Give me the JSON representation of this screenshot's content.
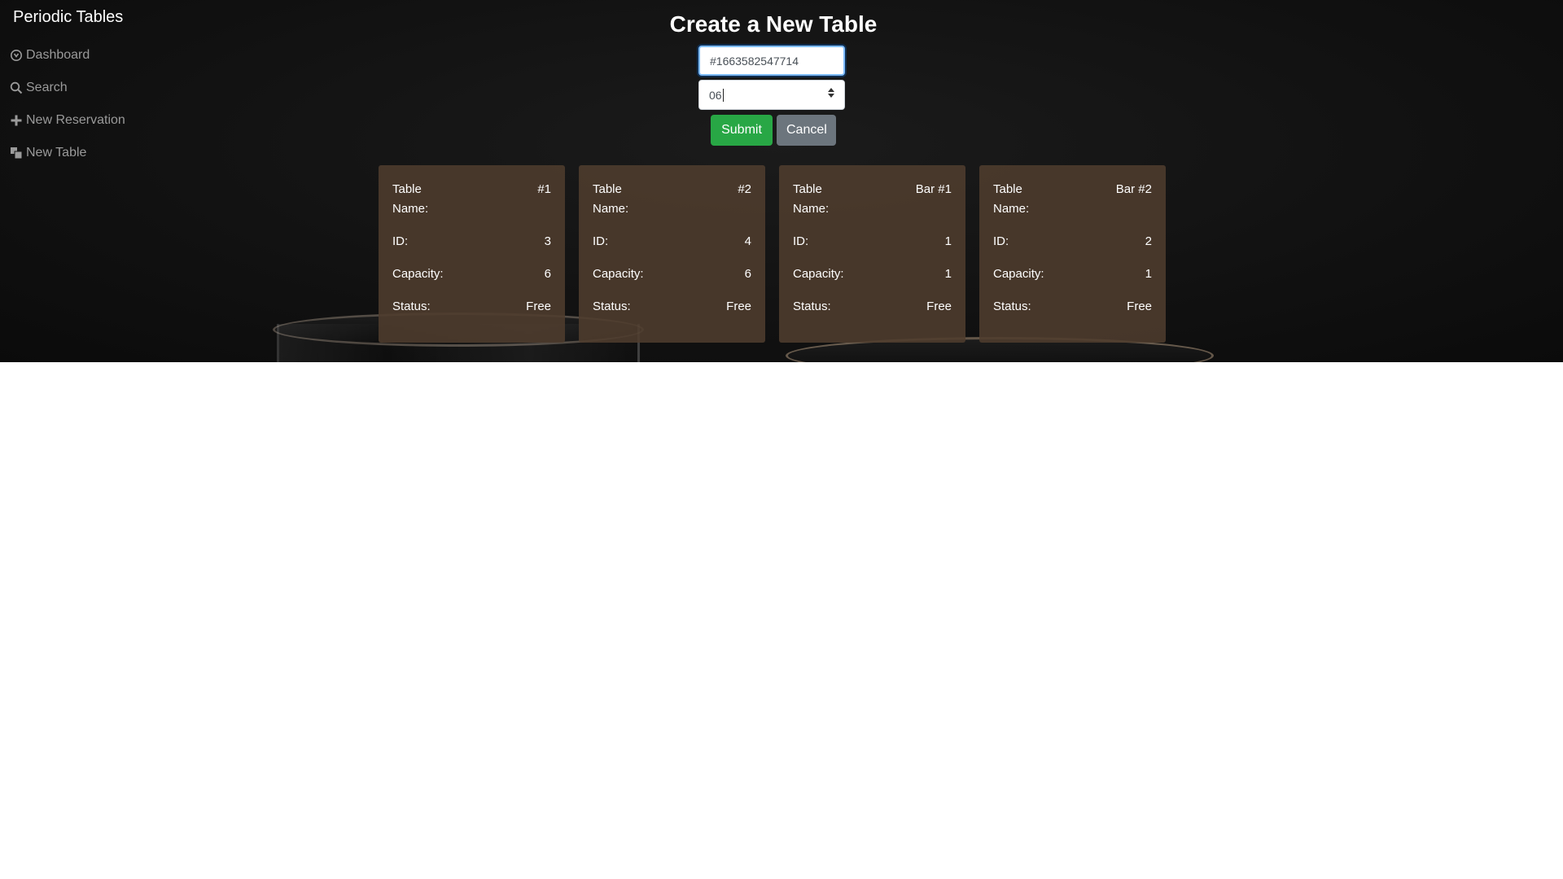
{
  "brand": "Periodic Tables",
  "nav": {
    "items": [
      {
        "label": "Dashboard",
        "icon": "dashboard-icon"
      },
      {
        "label": "Search",
        "icon": "search-icon"
      },
      {
        "label": "New Reservation",
        "icon": "plus-icon"
      },
      {
        "label": "New Table",
        "icon": "table-icon"
      }
    ]
  },
  "page": {
    "title": "Create a New Table"
  },
  "form": {
    "table_name_value": "#1663582547714",
    "capacity_value": "06",
    "submit_label": "Submit",
    "cancel_label": "Cancel"
  },
  "tables": [
    {
      "name_label": "Table Name:",
      "name": "#1",
      "id_label": "ID:",
      "id": "3",
      "capacity_label": "Capacity:",
      "capacity": "6",
      "status_label": "Status:",
      "status": "Free"
    },
    {
      "name_label": "Table Name:",
      "name": "#2",
      "id_label": "ID:",
      "id": "4",
      "capacity_label": "Capacity:",
      "capacity": "6",
      "status_label": "Status:",
      "status": "Free"
    },
    {
      "name_label": "Table Name:",
      "name": "Bar #1",
      "id_label": "ID:",
      "id": "1",
      "capacity_label": "Capacity:",
      "capacity": "1",
      "status_label": "Status:",
      "status": "Free"
    },
    {
      "name_label": "Table Name:",
      "name": "Bar #2",
      "id_label": "ID:",
      "id": "2",
      "capacity_label": "Capacity:",
      "capacity": "1",
      "status_label": "Status:",
      "status": "Free"
    }
  ],
  "colors": {
    "submit": "#28a745",
    "cancel": "#6c757d",
    "card": "#4e3c2e",
    "background": "#111111"
  }
}
